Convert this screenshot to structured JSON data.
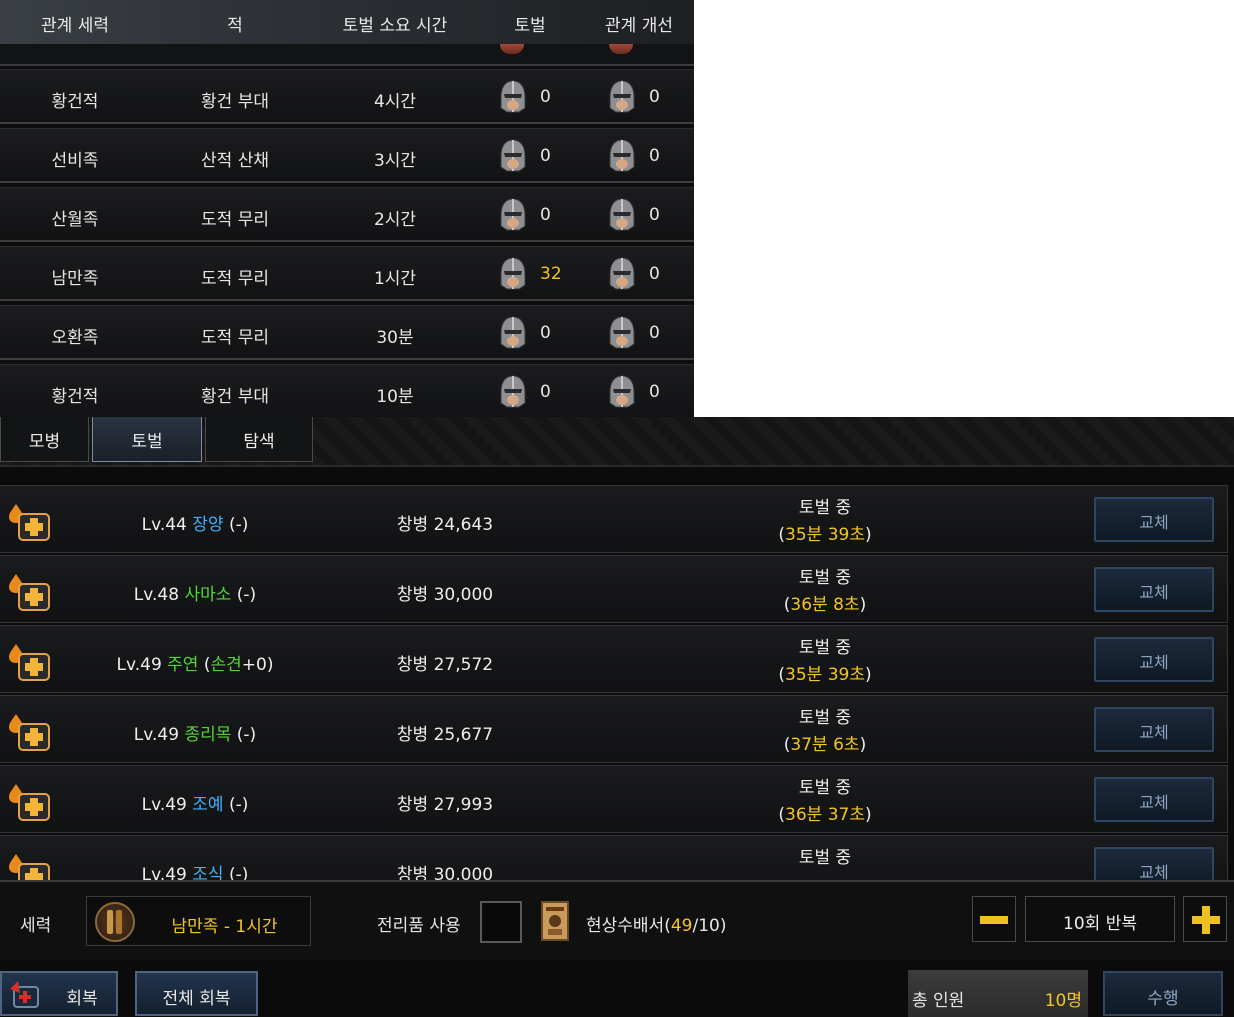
{
  "enemy_table": {
    "headers": [
      "관계 세력",
      "적",
      "토벌 소요 시간",
      "토벌",
      "관계 개선"
    ],
    "rows": [
      {
        "faction": "황건적",
        "enemy": "황건 부대",
        "time": "4시간",
        "subjugate": "0",
        "relation": "0",
        "highlight": false
      },
      {
        "faction": "선비족",
        "enemy": "산적 산채",
        "time": "3시간",
        "subjugate": "0",
        "relation": "0",
        "highlight": false
      },
      {
        "faction": "산월족",
        "enemy": "도적 무리",
        "time": "2시간",
        "subjugate": "0",
        "relation": "0",
        "highlight": false
      },
      {
        "faction": "남만족",
        "enemy": "도적 무리",
        "time": "1시간",
        "subjugate": "32",
        "relation": "0",
        "highlight": true
      },
      {
        "faction": "오환족",
        "enemy": "도적 무리",
        "time": "30분",
        "subjugate": "0",
        "relation": "0",
        "highlight": false
      },
      {
        "faction": "황건적",
        "enemy": "황건 부대",
        "time": "10분",
        "subjugate": "0",
        "relation": "0",
        "highlight": false
      }
    ]
  },
  "tabs": [
    {
      "label": "모병",
      "active": false
    },
    {
      "label": "토벌",
      "active": true
    },
    {
      "label": "탐색",
      "active": false
    }
  ],
  "officers": [
    {
      "level": "Lv.44",
      "name": "장양",
      "name_color": "blue",
      "suffix": "(-)",
      "extra": "",
      "troops": "창병 24,643",
      "status": "토벌 중",
      "timer": "35분 39초",
      "swap_label": "교체"
    },
    {
      "level": "Lv.48",
      "name": "사마소",
      "name_color": "green",
      "suffix": "(-)",
      "extra": "",
      "troops": "창병 30,000",
      "status": "토벌 중",
      "timer": "36분 8초",
      "swap_label": "교체"
    },
    {
      "level": "Lv.49",
      "name": "주연",
      "name_color": "green",
      "suffix": "",
      "extra": "손견",
      "troops": "창병 27,572",
      "status": "토벌 중",
      "timer": "35분 39초",
      "swap_label": "교체"
    },
    {
      "level": "Lv.49",
      "name": "종리목",
      "name_color": "green",
      "suffix": "(-)",
      "extra": "",
      "troops": "창병 25,677",
      "status": "토벌 중",
      "timer": "37분 6초",
      "swap_label": "교체"
    },
    {
      "level": "Lv.49",
      "name": "조예",
      "name_color": "blue",
      "suffix": "(-)",
      "extra": "",
      "troops": "창병 27,993",
      "status": "토벌 중",
      "timer": "36분 37초",
      "swap_label": "교체"
    },
    {
      "level": "Lv.49",
      "name": "조식",
      "name_color": "blue",
      "suffix": "(-)",
      "extra": "",
      "troops": "창병 30,000",
      "status": "토벌 중",
      "timer": "",
      "swap_label": "교체"
    }
  ],
  "settings": {
    "force_label": "세력",
    "force_value": "남만족 - 1시간",
    "booty_label": "전리품 사용",
    "wanted_label": "현상수배서",
    "wanted_current": "49",
    "wanted_max": "10",
    "repeat_value": "10회 반복"
  },
  "actions": {
    "recover_label": "회복",
    "recover_all_label": "전체 회복",
    "total_label": "총 인원",
    "total_value": "10명",
    "execute_label": "수행"
  },
  "colors": {
    "highlight_yellow": "#f3c623",
    "name_blue": "#3db3ff",
    "name_green": "#55d23b",
    "panel_bg": "#0b0b0c"
  },
  "icons": [
    "helmet-icon",
    "add-officer-icon",
    "force-emblem-icon",
    "wanted-poster-icon",
    "minus-icon",
    "plus-icon",
    "recover-icon"
  ]
}
